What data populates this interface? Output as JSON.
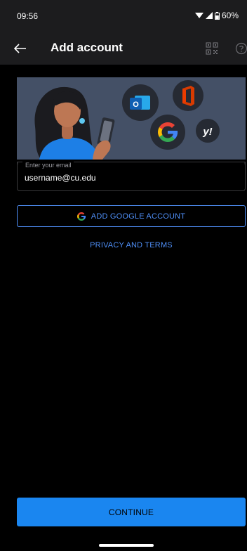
{
  "status_bar": {
    "time": "09:56",
    "battery": "60%",
    "icons": [
      "wifi-icon",
      "signal-icon",
      "battery-icon"
    ]
  },
  "app_bar": {
    "title": "Add account",
    "back_icon": "arrow-left-icon",
    "qr_icon": "qr-code-icon",
    "help_icon": "help-icon"
  },
  "hero": {
    "icons": [
      "woman-illustration",
      "outlook-icon",
      "office-icon",
      "google-icon",
      "yahoo-icon"
    ],
    "yahoo_text": "y!"
  },
  "email": {
    "label": "Enter your email",
    "value": "username@cu.edu"
  },
  "google_button": {
    "label": "ADD GOOGLE ACCOUNT"
  },
  "privacy": {
    "label": "PRIVACY AND TERMS"
  },
  "continue_button": {
    "label": "CONTINUE"
  },
  "colors": {
    "background": "#000000",
    "bar": "#1c1c1e",
    "accent": "#4f8ff7",
    "primary_button": "#1a86f0",
    "hero_bg": "#445066"
  }
}
